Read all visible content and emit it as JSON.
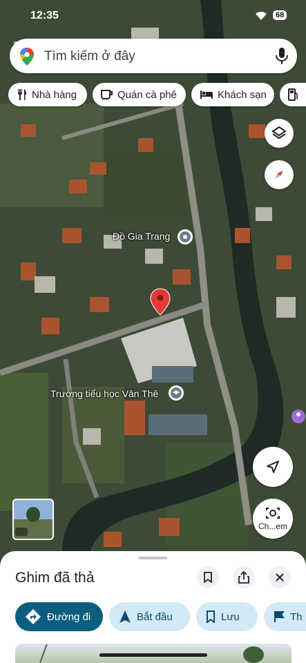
{
  "status_bar": {
    "time": "12:35",
    "battery": "68"
  },
  "search": {
    "placeholder": "Tìm kiếm ở đây"
  },
  "chips": [
    {
      "label": "Nhà hàng",
      "icon": "fork-knife-icon"
    },
    {
      "label": "Quán cà phê",
      "icon": "coffee-cup-icon"
    },
    {
      "label": "Khách sạn",
      "icon": "bed-icon"
    },
    {
      "label": "",
      "icon": "gas-station-icon"
    }
  ],
  "map": {
    "labels": [
      {
        "text": "Đồ Gia Trang",
        "icon": "place-marker-icon"
      },
      {
        "text": "Trường tiểu học Vân Thê",
        "icon": "school-icon"
      }
    ],
    "dropped_pin": {
      "icon": "red-pin-icon",
      "color": "#e53935"
    },
    "street_view_label": "Ch...em"
  },
  "sheet": {
    "title": "Ghim đã thả",
    "actions": [
      {
        "label": "Đường đi",
        "icon": "directions-icon"
      },
      {
        "label": "Bắt đầu",
        "icon": "navigation-arrow-icon"
      },
      {
        "label": "Lưu",
        "icon": "bookmark-icon"
      },
      {
        "label": "Th",
        "icon": "flag-icon"
      }
    ]
  },
  "colors": {
    "accent": "#0b5e7e",
    "chip_bg": "#d3e9f5",
    "pin": "#e53935"
  }
}
